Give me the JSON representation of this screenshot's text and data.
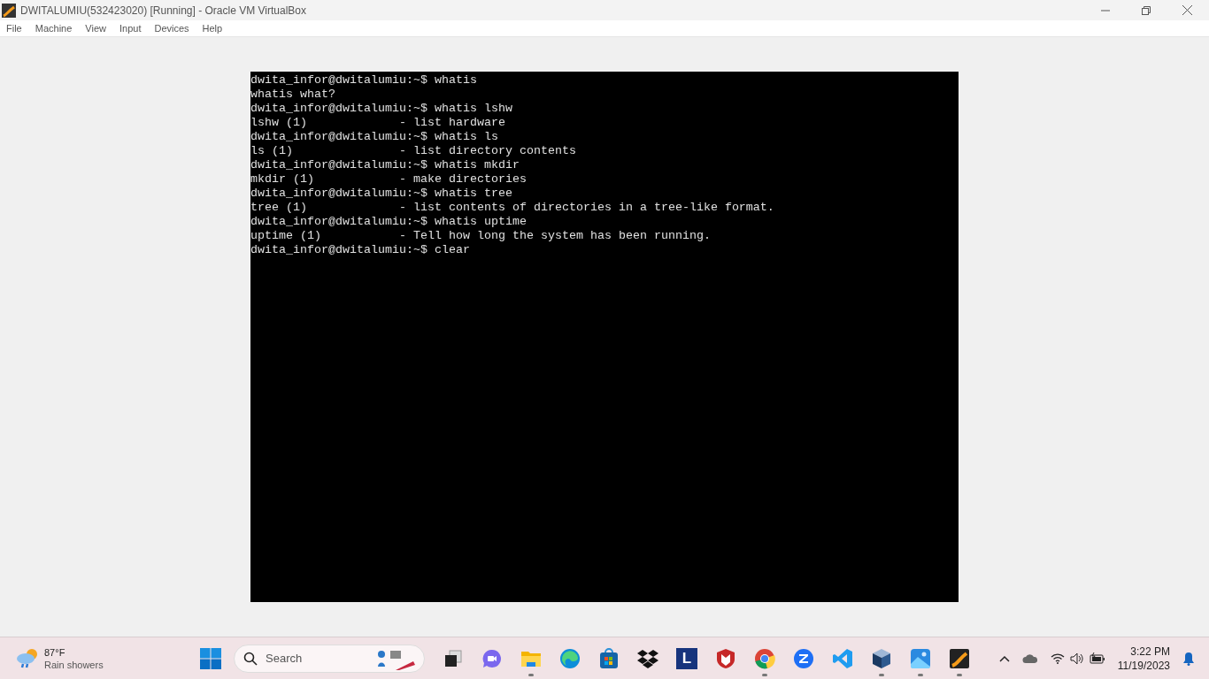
{
  "window": {
    "title": "DWITALUMIU(532423020) [Running] - Oracle VM VirtualBox"
  },
  "menu": [
    "File",
    "Machine",
    "View",
    "Input",
    "Devices",
    "Help"
  ],
  "terminal": {
    "lines": [
      "dwita_infor@dwitalumiu:~$ whatis",
      "whatis what?",
      "dwita_infor@dwitalumiu:~$ whatis lshw",
      "lshw (1)             - list hardware",
      "dwita_infor@dwitalumiu:~$ whatis ls",
      "ls (1)               - list directory contents",
      "dwita_infor@dwitalumiu:~$ whatis mkdir",
      "mkdir (1)            - make directories",
      "dwita_infor@dwitalumiu:~$ whatis tree",
      "tree (1)             - list contents of directories in a tree-like format.",
      "dwita_infor@dwitalumiu:~$ whatis uptime",
      "uptime (1)           - Tell how long the system has been running.",
      "dwita_infor@dwitalumiu:~$ clear"
    ]
  },
  "taskbar": {
    "weather": {
      "temperature": "87°F",
      "condition": "Rain showers"
    },
    "search": {
      "placeholder": "Search"
    },
    "apps": [
      {
        "kind": "taskview",
        "running": false
      },
      {
        "kind": "meet",
        "running": false
      },
      {
        "kind": "folder",
        "running": true
      },
      {
        "kind": "edge",
        "running": false
      },
      {
        "kind": "store",
        "running": false
      },
      {
        "kind": "dropbox",
        "running": false
      },
      {
        "kind": "letter",
        "label": "L",
        "running": false
      },
      {
        "kind": "shield",
        "running": false
      },
      {
        "kind": "chrome",
        "running": true
      },
      {
        "kind": "zoom",
        "running": false
      },
      {
        "kind": "vscode",
        "running": false
      },
      {
        "kind": "cube",
        "running": true
      },
      {
        "kind": "photos",
        "running": true
      },
      {
        "kind": "vbox",
        "running": true
      }
    ],
    "clock": {
      "time": "3:22 PM",
      "date": "11/19/2023"
    }
  }
}
